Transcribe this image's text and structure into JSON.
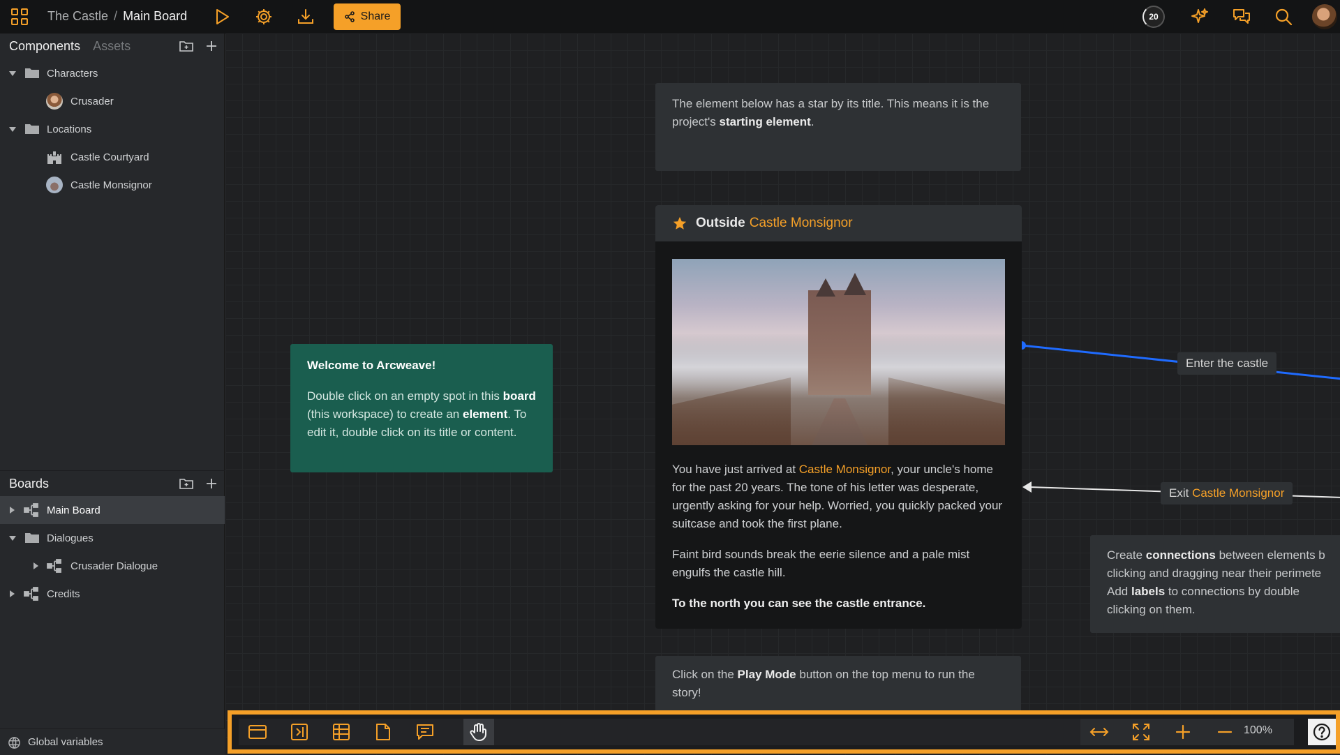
{
  "topbar": {
    "project": "The Castle",
    "separator": "/",
    "board": "Main Board",
    "share_label": "Share",
    "counter": "20"
  },
  "sidebar": {
    "tabs": {
      "components": "Components",
      "assets": "Assets"
    },
    "components": [
      {
        "label": "Characters",
        "type": "folder"
      },
      {
        "label": "Crusader",
        "type": "component"
      },
      {
        "label": "Locations",
        "type": "folder"
      },
      {
        "label": "Castle Courtyard",
        "type": "component"
      },
      {
        "label": "Castle Monsignor",
        "type": "component"
      }
    ],
    "boards_title": "Boards",
    "boards": [
      {
        "label": "Main Board"
      },
      {
        "label": "Dialogues"
      },
      {
        "label": "Crusader Dialogue"
      },
      {
        "label": "Credits"
      }
    ],
    "global_variables": "Global variables"
  },
  "canvas": {
    "note_top": {
      "text1": "The element below has a star by its title. This means it is the project's ",
      "bold": "starting element",
      "text2": "."
    },
    "welcome": {
      "title": "Welcome to Arcweave!",
      "t1": "Double click on an empty spot in this ",
      "b1": "board",
      "t2": " (this workspace) to create an ",
      "b2": "element",
      "t3": ". To edit it, double click on its title or content."
    },
    "element": {
      "title_plain": "Outside",
      "title_link": "Castle Monsignor",
      "p1_a": "You have just arrived at ",
      "p1_link": "Castle Monsignor",
      "p1_b": ", your uncle's home for the past 20 years. The tone of his letter was desperate, urgently asking for your help. Worried, you quickly packed your suitcase and took the first plane.",
      "p2": "Faint bird sounds break the eerie silence and a pale mist engulfs the castle hill.",
      "p3": "To the north you can see the castle entrance."
    },
    "connection_enter": "Enter the castle",
    "connection_exit_plain": "Exit",
    "connection_exit_link": "Castle Monsignor",
    "note_right": {
      "t1": "Create ",
      "b1": "connections",
      "t2": " between elements b",
      "t3": "clicking and dragging near their perimete",
      "t4": "Add ",
      "b2": "labels",
      "t5": " to connections by double",
      "t6": "clicking on them."
    },
    "note_bottom": {
      "t1": "Click on the ",
      "b1": "Play Mode",
      "t2": " button on the top menu to run the story!"
    }
  },
  "bottombar": {
    "zoom": "100%"
  },
  "colors": {
    "accent": "#f5a028",
    "connection_blue": "#1f6bff",
    "welcome_bg": "#1a5e4f"
  }
}
